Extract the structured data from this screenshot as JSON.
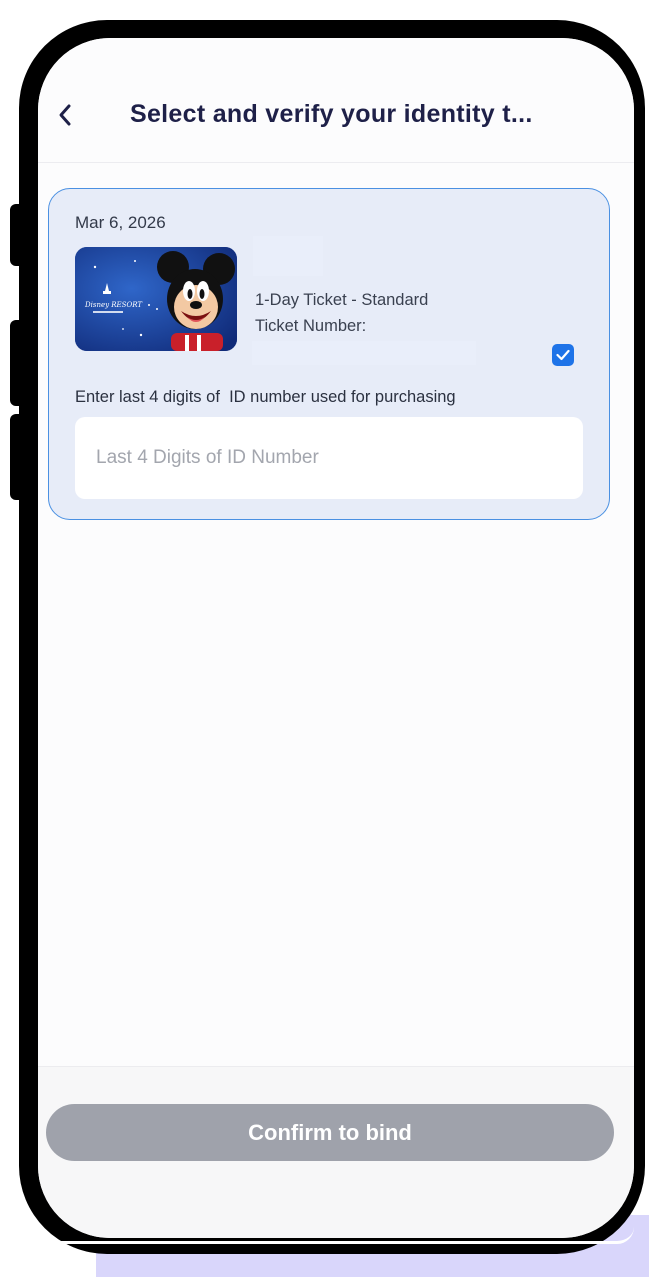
{
  "header": {
    "title": "Select and verify your identity t...",
    "back_icon": "chevron-left-icon"
  },
  "ticket": {
    "date": "Mar 6, 2026",
    "name": "1-Day Ticket - Standard",
    "number_label": "Ticket Number:",
    "selected": true,
    "checkbox_color": "#1e73e8",
    "thumbnail": "disney-resort-mickey-ticket-image"
  },
  "verification": {
    "label": "Enter last 4 digits of  ID number used for purchasing",
    "input_value": "",
    "input_placeholder": "Last 4 Digits of ID Number"
  },
  "footer": {
    "confirm_label": "Confirm to bind",
    "confirm_color": "#9fa2ab"
  },
  "colors": {
    "card_border": "#4a90e2",
    "card_bg": "#e7ecf8",
    "title_text": "#1e2048"
  }
}
